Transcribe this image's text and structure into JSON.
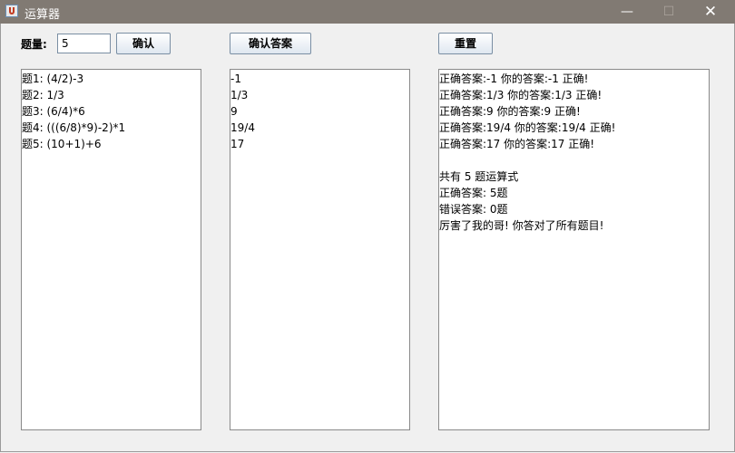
{
  "window": {
    "title": "运算器",
    "minimize_glyph": "—",
    "maximize_glyph": "☐",
    "close_glyph": "✕"
  },
  "toolbar": {
    "count_label": "题量:",
    "count_value": "5",
    "confirm_label": "确认",
    "confirm_answer_label": "确认答案",
    "reset_label": "重置"
  },
  "questions": [
    "题1: (4/2)-3",
    "题2: 1/3",
    "题3: (6/4)*6",
    "题4: (((6/8)*9)-2)*1",
    "题5: (10+1)+6"
  ],
  "answers": [
    "-1",
    "1/3",
    "9",
    "19/4",
    "17"
  ],
  "results": [
    "正确答案:-1 你的答案:-1 正确!",
    "正确答案:1/3 你的答案:1/3 正确!",
    "正确答案:9 你的答案:9 正确!",
    "正确答案:19/4 你的答案:19/4 正确!",
    "正确答案:17 你的答案:17 正确!",
    "",
    "共有 5 题运算式",
    "正确答案: 5题",
    "错误答案: 0题",
    "厉害了我的哥! 你答对了所有题目!"
  ],
  "icons": {
    "app": "java-cup-icon"
  }
}
